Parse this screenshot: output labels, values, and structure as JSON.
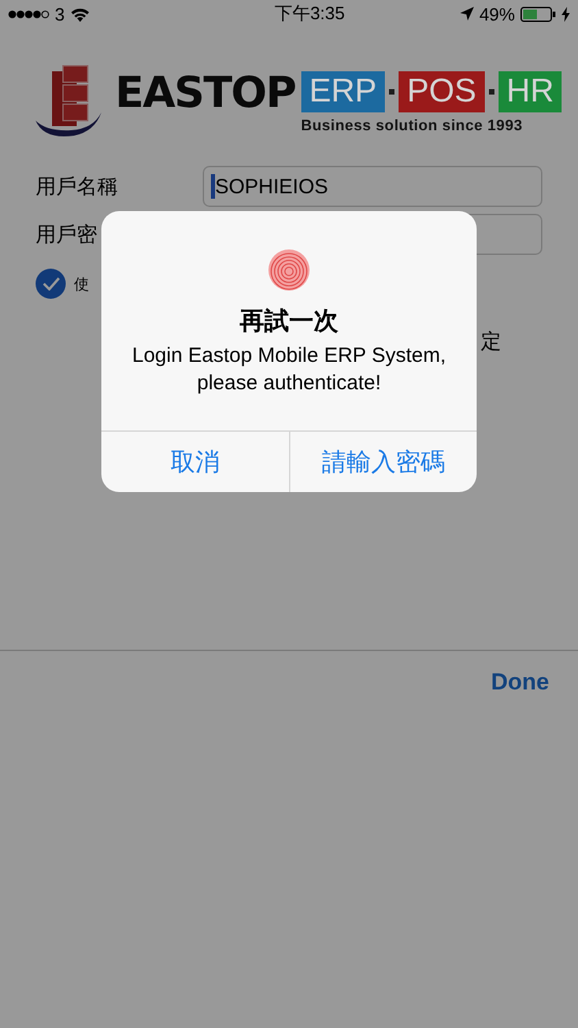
{
  "status_bar": {
    "carrier": "3",
    "time": "下午3:35",
    "battery": "49%"
  },
  "logo": {
    "brand": "EASTOP",
    "modules": [
      {
        "label": "ERP",
        "color": "#1c6aa0"
      },
      {
        "label": "POS",
        "color": "#9a1a1a"
      },
      {
        "label": "HR",
        "color": "#1a8a3a"
      }
    ],
    "tagline": "Business solution since 1993"
  },
  "form": {
    "fields": [
      {
        "label": "用戶名稱",
        "value": "SOPHIEIOS",
        "focused": true
      },
      {
        "label": "用戶密"
      }
    ],
    "checkbox": {
      "label": "使",
      "checked": true
    },
    "trailing_text": "定"
  },
  "alert": {
    "title": "再試一次",
    "message": "Login Eastop Mobile ERP System, please authenticate!",
    "buttons": [
      "取消",
      "請輸入密碼"
    ]
  },
  "toolbar": {
    "done": "Done"
  }
}
